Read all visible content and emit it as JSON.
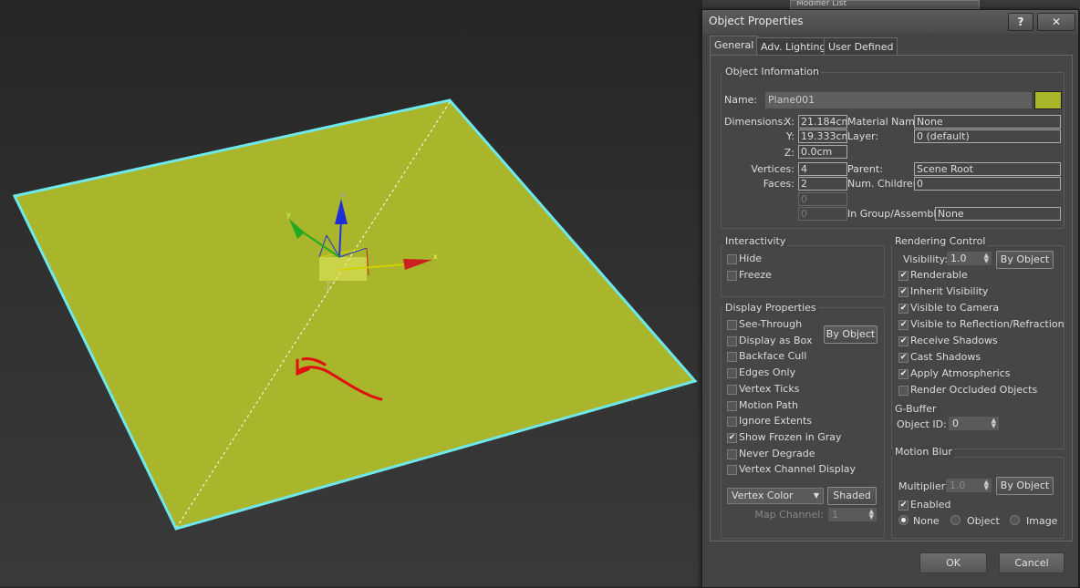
{
  "viewport": {
    "modifier_list": "Modifier List"
  },
  "dialog": {
    "title": "Object Properties",
    "help_btn": "?",
    "close_btn": "✕",
    "tabs": [
      "General",
      "Adv. Lighting",
      "User Defined"
    ],
    "object_info": {
      "group_title": "Object Information",
      "name_label": "Name:",
      "name_value": "Plane001",
      "color": "#a8b529",
      "dimensions_label": "Dimensions:",
      "x_label": "X:",
      "x_value": "21.184cm",
      "y_label": "Y:",
      "y_value": "19.333cm",
      "z_label": "Z:",
      "z_value": "0.0cm",
      "vertices_label": "Vertices:",
      "vertices_value": "4",
      "faces_label": "Faces:",
      "faces_value": "2",
      "extra1": "0",
      "extra2": "0",
      "material_label": "Material Name:",
      "material_value": "None",
      "layer_label": "Layer:",
      "layer_value": "0 (default)",
      "parent_label": "Parent:",
      "parent_value": "Scene Root",
      "children_label": "Num. Children:",
      "children_value": "0",
      "group_label": "In Group/Assembly:",
      "group_value": "None"
    },
    "interactivity": {
      "title": "Interactivity",
      "items": [
        {
          "label": "Hide",
          "checked": false
        },
        {
          "label": "Freeze",
          "checked": false
        }
      ]
    },
    "display": {
      "title": "Display Properties",
      "by_object": "By Object",
      "items": [
        {
          "label": "See-Through",
          "checked": false
        },
        {
          "label": "Display as Box",
          "checked": false
        },
        {
          "label": "Backface Cull",
          "checked": false
        },
        {
          "label": "Edges Only",
          "checked": false
        },
        {
          "label": "Vertex Ticks",
          "checked": false
        },
        {
          "label": "Motion Path",
          "checked": false
        },
        {
          "label": "Ignore Extents",
          "checked": false
        },
        {
          "label": "Show Frozen in Gray",
          "checked": true
        },
        {
          "label": "Never Degrade",
          "checked": false
        },
        {
          "label": "Vertex Channel Display",
          "checked": false
        }
      ],
      "vertex_color": "Vertex Color",
      "shaded": "Shaded",
      "map_channel_label": "Map Channel:",
      "map_channel_value": "1"
    },
    "rendering": {
      "title": "Rendering Control",
      "visibility_label": "Visibility:",
      "visibility_value": "1.0",
      "by_object": "By Object",
      "items": [
        {
          "label": "Renderable",
          "checked": true
        },
        {
          "label": "Inherit Visibility",
          "checked": true
        },
        {
          "label": "Visible to Camera",
          "checked": true
        },
        {
          "label": "Visible to Reflection/Refraction",
          "checked": true
        },
        {
          "label": "Receive Shadows",
          "checked": true
        },
        {
          "label": "Cast Shadows",
          "checked": true
        },
        {
          "label": "Apply Atmospherics",
          "checked": true
        },
        {
          "label": "Render Occluded Objects",
          "checked": false
        }
      ]
    },
    "gbuffer": {
      "title": "G-Buffer",
      "object_id_label": "Object ID:",
      "object_id_value": "0"
    },
    "motion_blur": {
      "title": "Motion Blur",
      "multiplier_label": "Multiplier:",
      "multiplier_value": "1.0",
      "by_object": "By Object",
      "enabled_label": "Enabled",
      "enabled_checked": true,
      "radios": [
        "None",
        "Object",
        "Image"
      ],
      "selected_radio": "None"
    },
    "ok": "OK",
    "cancel": "Cancel"
  }
}
